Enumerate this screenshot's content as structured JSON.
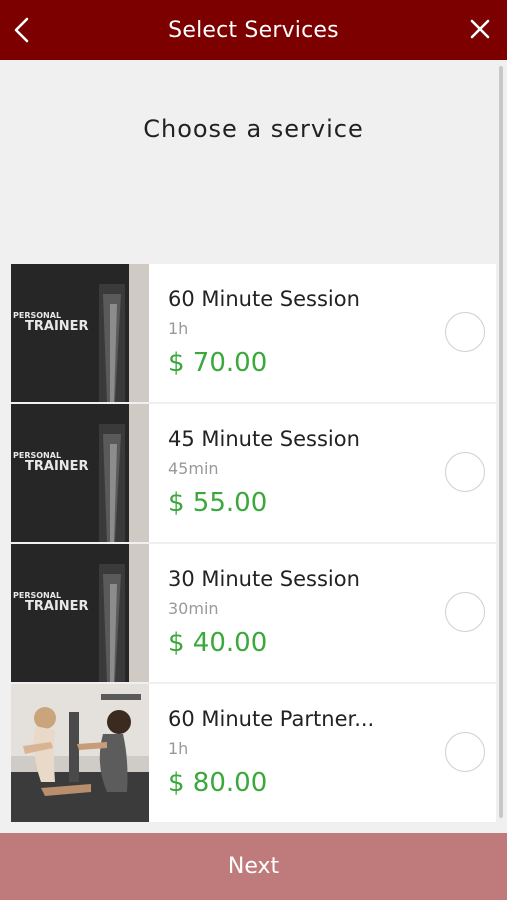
{
  "header": {
    "title": "Select Services",
    "back_icon": "chevron-left-icon",
    "close_icon": "close-icon",
    "background": "#7d0000"
  },
  "prompt": "Choose a service",
  "services": [
    {
      "name": "60 Minute Session",
      "duration": "1h",
      "price": "$ 70.00",
      "image_text": [
        "PERSONAL",
        "TRAINER"
      ],
      "image": "personal-trainer-shirt"
    },
    {
      "name": "45 Minute Session",
      "duration": "45min",
      "price": "$ 55.00",
      "image_text": [
        "PERSONAL",
        "TRAINER"
      ],
      "image": "personal-trainer-shirt"
    },
    {
      "name": "30 Minute Session",
      "duration": "30min",
      "price": "$ 40.00",
      "image_text": [
        "PERSONAL",
        "TRAINER"
      ],
      "image": "personal-trainer-shirt"
    },
    {
      "name": "60 Minute Partner...",
      "duration": "1h",
      "price": "$ 80.00",
      "image": "partner-workout-photo"
    }
  ],
  "next_button": {
    "label": "Next",
    "background": "#bf7b7b"
  },
  "colors": {
    "price": "#3aa83a",
    "page_bg": "#f0f0f0"
  }
}
